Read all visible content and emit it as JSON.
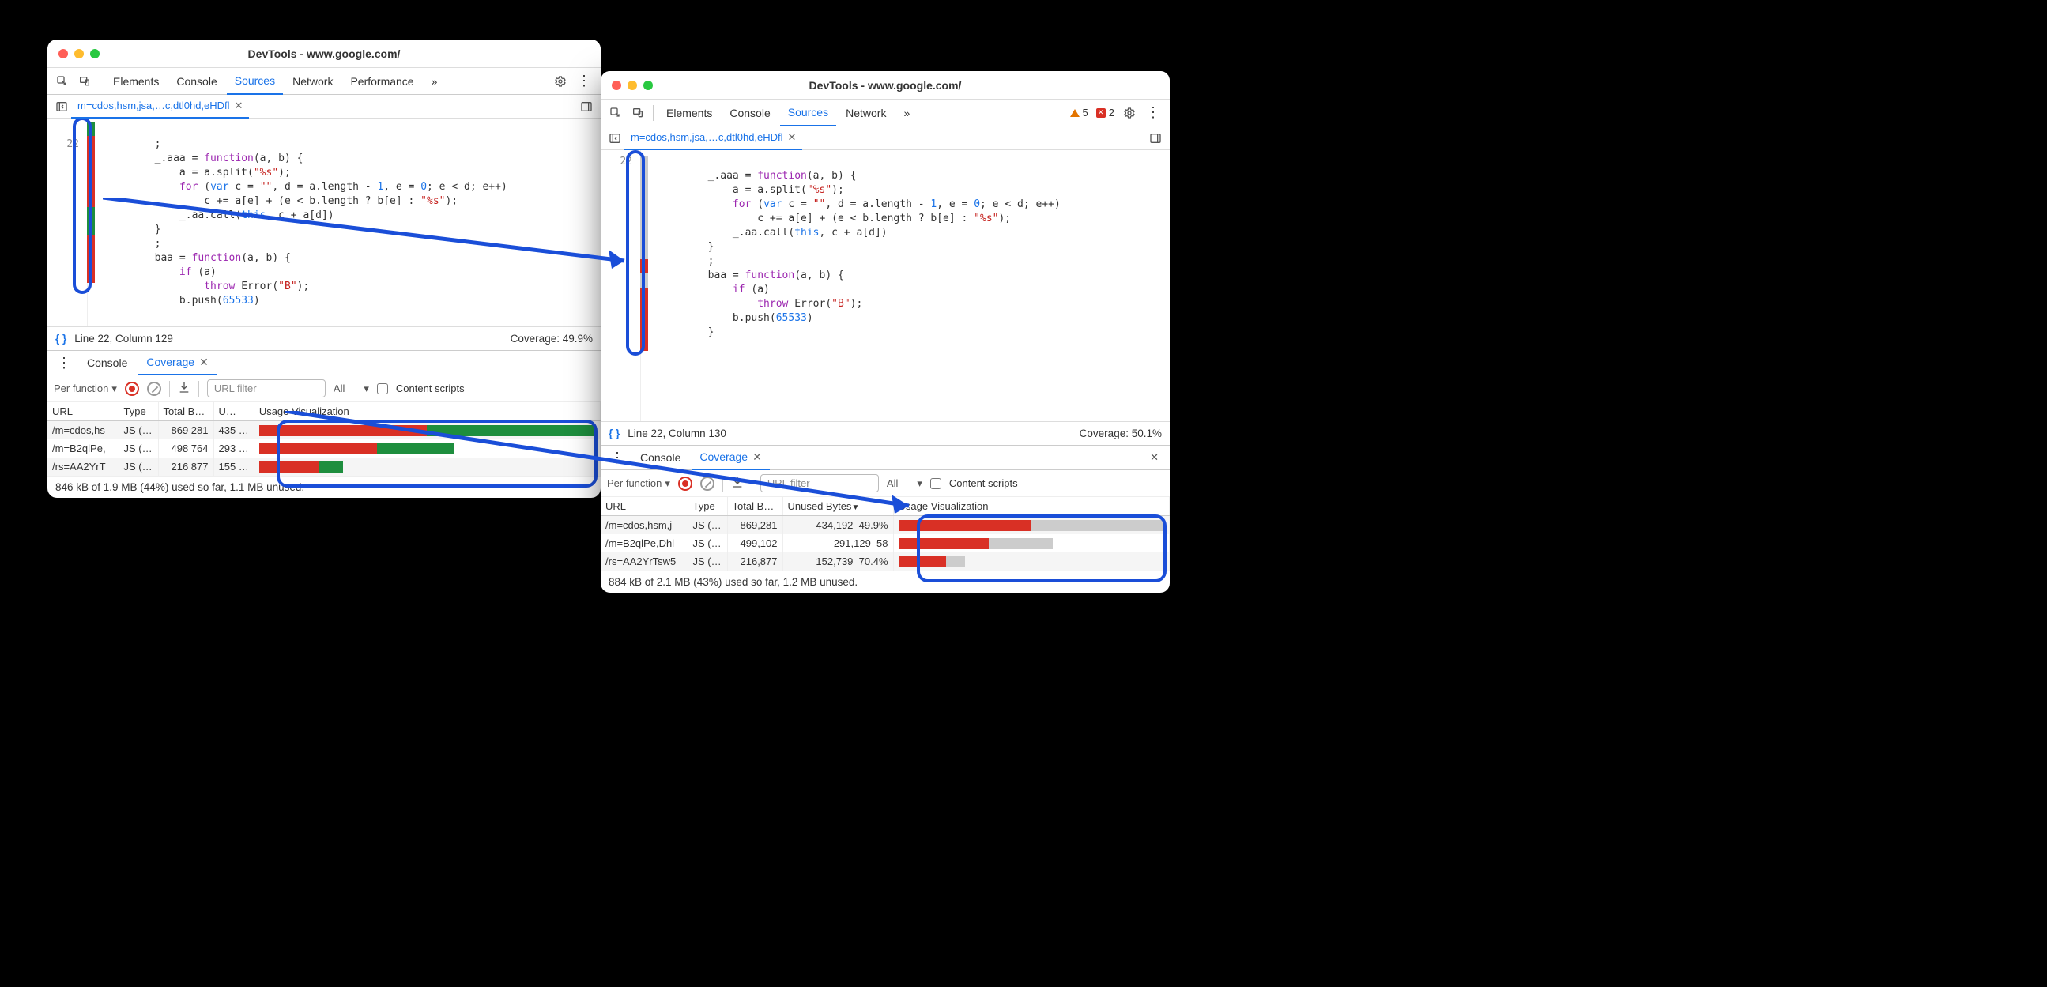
{
  "left": {
    "title": "DevTools - www.google.com/",
    "tabs": [
      "Elements",
      "Console",
      "Sources",
      "Network",
      "Performance"
    ],
    "active_tab": "Sources",
    "more": "»",
    "file_tab": "m=cdos,hsm,jsa,…c,dtl0hd,eHDfl",
    "status": {
      "line": "Line 22, Column 129",
      "coverage": "Coverage: 49.9%"
    },
    "drawer": {
      "tabs": [
        "Console",
        "Coverage"
      ],
      "active": "Coverage"
    },
    "cov_toolbar": {
      "mode": "Per function",
      "url_placeholder": "URL filter",
      "type_filter": "All",
      "content_scripts": "Content scripts"
    },
    "cov_headers": [
      "URL",
      "Type",
      "Total B…",
      "U…",
      "Usage Visualization"
    ],
    "cov_rows": [
      {
        "url": "/m=cdos,hs",
        "type": "JS (…",
        "total": "869 281",
        "unused": "435 …",
        "red": 50,
        "green": 50,
        "width": 100,
        "grey": false
      },
      {
        "url": "/m=B2qlPe,",
        "type": "JS (…",
        "total": "498 764",
        "unused": "293 …",
        "red": 35,
        "green": 23,
        "width": 58,
        "grey": false
      },
      {
        "url": "/rs=AA2YrT",
        "type": "JS (…",
        "total": "216 877",
        "unused": "155 …",
        "red": 18,
        "green": 7,
        "width": 25,
        "grey": false
      }
    ],
    "cov_footer": "846 kB of 1.9 MB (44%) used so far, 1.1 MB unused.",
    "line_no": "22"
  },
  "right": {
    "title": "DevTools - www.google.com/",
    "tabs": [
      "Elements",
      "Console",
      "Sources",
      "Network"
    ],
    "active_tab": "Sources",
    "more": "»",
    "warn_count": "5",
    "err_count": "2",
    "file_tab": "m=cdos,hsm,jsa,…c,dtl0hd,eHDfl",
    "status": {
      "line": "Line 22, Column 130",
      "coverage": "Coverage: 50.1%"
    },
    "drawer": {
      "tabs": [
        "Console",
        "Coverage"
      ],
      "active": "Coverage"
    },
    "cov_toolbar": {
      "mode": "Per function",
      "url_placeholder": "URL filter",
      "type_filter": "All",
      "content_scripts": "Content scripts"
    },
    "cov_headers": [
      "URL",
      "Type",
      "Total B…",
      "Unused Bytes",
      "Usage Visualization"
    ],
    "cov_rows": [
      {
        "url": "/m=cdos,hsm,j",
        "type": "JS (…",
        "total": "869,281",
        "unused": "434,192",
        "pct": "49.9%",
        "red": 50,
        "grey": 50,
        "width": 100
      },
      {
        "url": "/m=B2qlPe,Dhl",
        "type": "JS (…",
        "total": "499,102",
        "unused": "291,129",
        "pct": "58",
        "red": 34,
        "grey": 24,
        "width": 58
      },
      {
        "url": "/rs=AA2YrTsw5",
        "type": "JS (…",
        "total": "216,877",
        "unused": "152,739",
        "pct": "70.4%",
        "red": 18,
        "grey": 7,
        "width": 25
      }
    ],
    "cov_footer": "884 kB of 2.1 MB (43%) used so far, 1.2 MB unused.",
    "line_no": "22"
  },
  "code": {
    "l1": "        ;",
    "l2": "        _.aaa = ",
    "l2_fn": "function",
    "l2b": "(a, b) {",
    "l3": "            a = a.split(",
    "l3_s": "\"%s\"",
    "l3b": ");",
    "l4a": "            ",
    "l4_for": "for",
    "l4b": " (",
    "l4_var": "var",
    "l4c": " c = ",
    "l4_s": "\"\"",
    "l4d": ", d = a.length - ",
    "l4_n1": "1",
    "l4e": ", e = ",
    "l4_n0": "0",
    "l4f": "; e < d; e++)",
    "l5a": "                c += a[e] + (e < b.length ? b[e] : ",
    "l5_s": "\"%s\"",
    "l5b": ");",
    "l6a": "            _.aa.call(",
    "l6_this": "this",
    "l6b": ", c + a[d])",
    "l7": "        }",
    "l8": "        ;",
    "l9a": "        baa = ",
    "l9_fn": "function",
    "l9b": "(a, b) {",
    "l10a": "            ",
    "l10_if": "if",
    "l10b": " (a)",
    "l11a": "                ",
    "l11_throw": "throw",
    "l11b": " Error(",
    "l11_s": "\"B\"",
    "l11c": ");",
    "l12a": "            b.push(",
    "l12_n": "65533",
    "l12b": ")",
    "l13": "        }"
  }
}
